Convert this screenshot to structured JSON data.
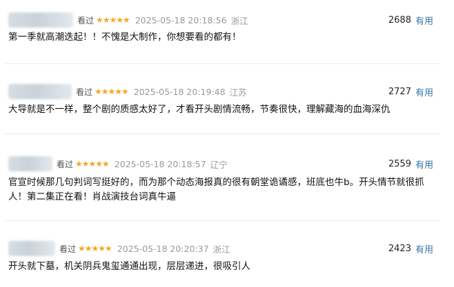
{
  "comments": [
    {
      "watched_label": "看过",
      "stars": "★★★★★",
      "time": "2025-05-18 20:18:56",
      "location": "浙江",
      "votes": "2688",
      "useful_label": "有用",
      "text": "第一季就高潮迭起！！不愧是大制作，你想要看的都有！"
    },
    {
      "watched_label": "看过",
      "stars": "★★★★★",
      "time": "2025-05-18 20:19:48",
      "location": "江苏",
      "votes": "2727",
      "useful_label": "有用",
      "text": "大导就是不一样，整个剧的质感太好了，才看开头剧情流畅，节奏很快，理解藏海的血海深仇"
    },
    {
      "watched_label": "看过",
      "stars": "★★★★★",
      "time": "2025-05-18 20:18:57",
      "location": "辽宁",
      "votes": "2559",
      "useful_label": "有用",
      "text": "官宣时候那几句判词写挺好的，而为那个动态海报真的很有朝堂诡谲感，班底也牛b。开头情节就很抓人！第二集正在看！肖战演技台词真牛逼"
    },
    {
      "watched_label": "看过",
      "stars": "★★★★★",
      "time": "2025-05-18 20:20:37",
      "location": "浙江",
      "votes": "2423",
      "useful_label": "有用",
      "text": "开头就下墓，机关阴兵鬼玺通通出现，层层递进，很吸引人"
    }
  ],
  "colors": {
    "star": "#f5a623",
    "link": "#3377aa",
    "muted": "#999999"
  }
}
